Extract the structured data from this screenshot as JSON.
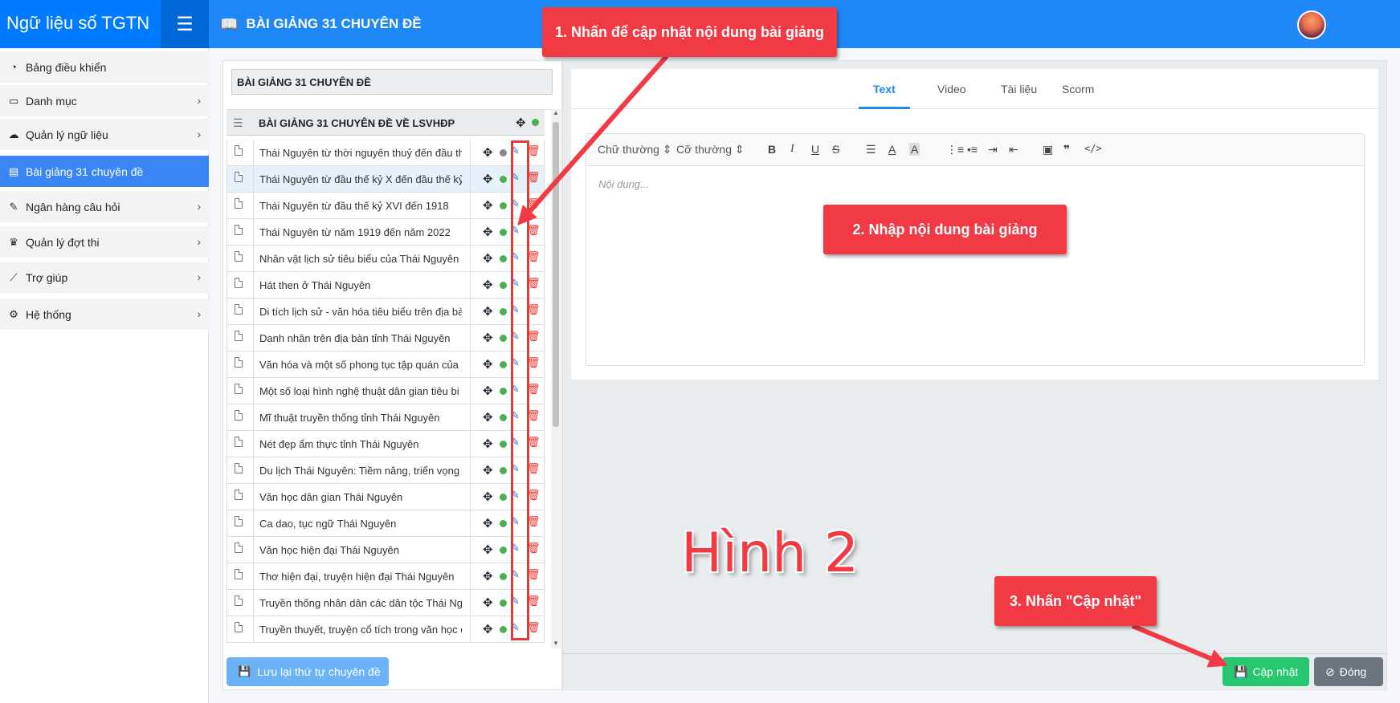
{
  "app": {
    "brand": "Ngữ liệu số TGTN",
    "page_title": "BÀI GIẢNG 31 CHUYÊN ĐỀ"
  },
  "sidebar": {
    "items": [
      {
        "label": "Bảng điều khiển",
        "icon": "dashboard-icon",
        "has_chevron": false,
        "active": false
      },
      {
        "label": "Danh mục",
        "icon": "folder-icon",
        "has_chevron": true,
        "active": false
      },
      {
        "label": "Quản lý ngữ liệu",
        "icon": "cloud-icon",
        "has_chevron": true,
        "active": false
      },
      {
        "label": "Bài giảng 31 chuyên đề",
        "icon": "book-icon",
        "has_chevron": false,
        "active": true
      },
      {
        "label": "Ngân hàng câu hỏi",
        "icon": "edit-icon",
        "has_chevron": true,
        "active": false
      },
      {
        "label": "Quản lý đợt thi",
        "icon": "trophy-icon",
        "has_chevron": true,
        "active": false
      },
      {
        "label": "Trợ giúp",
        "icon": "chart-icon",
        "has_chevron": true,
        "active": false
      },
      {
        "label": "Hệ thống",
        "icon": "gears-icon",
        "has_chevron": true,
        "active": false
      }
    ]
  },
  "left_panel": {
    "course_title": "BÀI GIẢNG 31 CHUYÊN ĐỀ",
    "list_header": "BÀI GIẢNG 31 CHUYÊN ĐỀ VỀ LSVHĐP",
    "topics": [
      {
        "name": "Thái Nguyên từ thời nguyên thuỷ đến đầu th",
        "status": "gray",
        "selected": false
      },
      {
        "name": "Thái Nguyên từ đầu thế kỷ X đến đầu thế kỷ",
        "status": "green",
        "selected": true
      },
      {
        "name": "Thái Nguyên từ đầu thế kỷ XVI đến 1918",
        "status": "green",
        "selected": false
      },
      {
        "name": "Thái Nguyên từ năm 1919 đến năm 2022",
        "status": "green",
        "selected": false
      },
      {
        "name": "Nhân vật lịch sử tiêu biểu của Thái Nguyên t",
        "status": "green",
        "selected": false
      },
      {
        "name": "Hát then ở Thái Nguyên",
        "status": "green",
        "selected": false
      },
      {
        "name": "Di tích lịch sử - văn hóa tiêu biểu trên địa bà",
        "status": "green",
        "selected": false
      },
      {
        "name": "Danh nhân trên địa bàn tỉnh Thái Nguyên",
        "status": "green",
        "selected": false
      },
      {
        "name": "Văn hóa và một số phong tục tập quán của",
        "status": "green",
        "selected": false
      },
      {
        "name": "Một số loại hình nghệ thuật dân gian tiêu bi",
        "status": "green",
        "selected": false
      },
      {
        "name": "Mĩ thuật truyền thống tỉnh Thái Nguyên",
        "status": "green",
        "selected": false
      },
      {
        "name": "Nét đẹp ẩm thực tỉnh Thái Nguyên",
        "status": "green",
        "selected": false
      },
      {
        "name": "Du lịch Thái Nguyên: Tiềm năng, triển vọng",
        "status": "green",
        "selected": false
      },
      {
        "name": "Văn học dân gian Thái Nguyên",
        "status": "green",
        "selected": false
      },
      {
        "name": "Ca dao, tục ngữ Thái Nguyên",
        "status": "green",
        "selected": false
      },
      {
        "name": "Văn học hiện đại Thái Nguyên",
        "status": "green",
        "selected": false
      },
      {
        "name": "Thơ hiện đại, truyện hiện đại Thái Nguyên",
        "status": "green",
        "selected": false
      },
      {
        "name": "Truyền thống nhân dân các dân tộc Thái Ng",
        "status": "green",
        "selected": false
      },
      {
        "name": "Truyền thuyết, truyện cổ tích trong văn học c",
        "status": "green",
        "selected": false
      }
    ],
    "save_order_label": "Lưu lại thứ tự chuyên đề"
  },
  "editor": {
    "tabs": [
      "Text",
      "Video",
      "Tài liệu",
      "Scorm"
    ],
    "active_tab": "Text",
    "font_style": "Chữ thường",
    "font_size": "Cỡ thường",
    "placeholder": "Nội dung...",
    "update_label": "Cập nhật",
    "close_label": "Đóng"
  },
  "annotations": {
    "step1": "1. Nhấn để cập nhật nội dung bài giảng",
    "step2": "2. Nhập nội dung bài giảng",
    "step3": "3. Nhấn \"Cập nhật\"",
    "figure_label": "Hình 2"
  },
  "colors": {
    "primary": "#1e88f7",
    "active_sidebar": "#3a86f4",
    "success": "#28c76f",
    "secondary": "#6c757d",
    "annotation_red": "#f23a45",
    "status_green": "#4caf50"
  }
}
